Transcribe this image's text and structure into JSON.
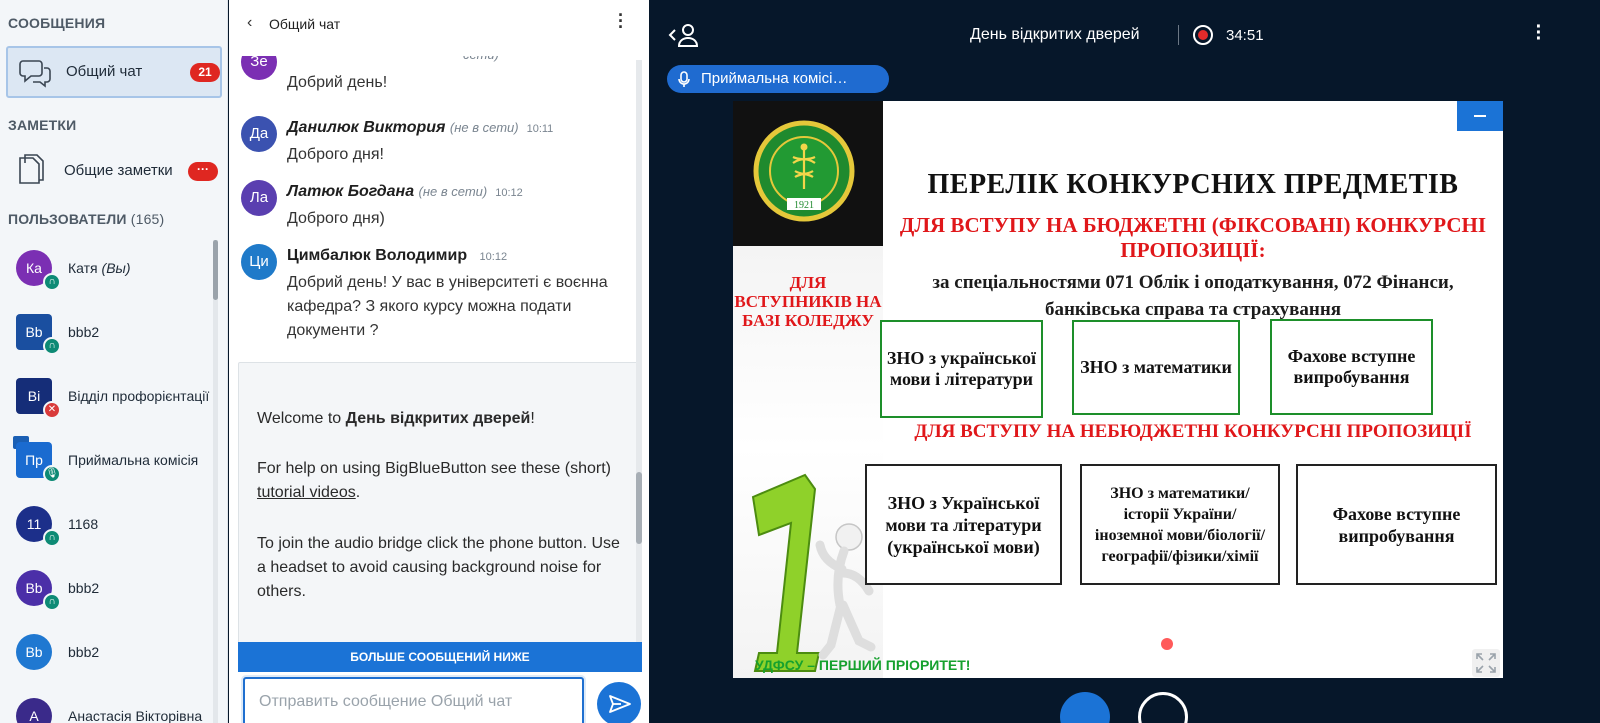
{
  "sidebar": {
    "messages_title": "СООБЩЕНИЯ",
    "public_chat": {
      "label": "Общий чат",
      "unread": "21"
    },
    "notes_title": "ЗАМЕТКИ",
    "shared_notes": {
      "label": "Общие заметки",
      "badge": "···"
    },
    "users_title": "ПОЛЬЗОВАТЕЛИ",
    "users_count": "(165)",
    "users": [
      {
        "initials": "Ка",
        "name": "Катя",
        "suffix": "(Вы)",
        "color": "#7b2fb3",
        "shape": "circle",
        "status": "headphones",
        "status_color": "#0d8a75"
      },
      {
        "initials": "Bb",
        "name": "bbb2",
        "suffix": "",
        "color": "#1a4fa0",
        "shape": "square",
        "status": "headphones",
        "status_color": "#0d8a75"
      },
      {
        "initials": "Bi",
        "name": "Відділ профорієнтації",
        "suffix": "",
        "color": "#152d78",
        "shape": "square",
        "status": "mic-muted",
        "status_color": "#d93b3b"
      },
      {
        "initials": "Пр",
        "name": "Приймальна комісія",
        "suffix": "",
        "color": "#1a6bd0",
        "shape": "square",
        "status": "mic",
        "status_color": "#0d8a75",
        "presenter": true
      },
      {
        "initials": "11",
        "name": "1168",
        "suffix": "",
        "color": "#1c2f8a",
        "shape": "circle",
        "status": "headphones",
        "status_color": "#0d8a75"
      },
      {
        "initials": "Bb",
        "name": "bbb2",
        "suffix": "",
        "color": "#4b2fa8",
        "shape": "circle",
        "status": "headphones",
        "status_color": "#0d8a75"
      },
      {
        "initials": "Bb",
        "name": "bbb2",
        "suffix": "",
        "color": "#1f78d1",
        "shape": "circle",
        "status": "",
        "status_color": ""
      },
      {
        "initials": "А",
        "name": "Анастасія Вікторівна",
        "suffix": "",
        "color": "#3a2a8a",
        "shape": "circle",
        "status": "",
        "status_color": ""
      }
    ]
  },
  "chat": {
    "title": "Общий чат",
    "messages": [
      {
        "initials": "Зе",
        "color": "#7b2fb3",
        "author": "",
        "offline": "сети)",
        "time": "",
        "text": "Добрий день!"
      },
      {
        "initials": "Да",
        "color": "#3b52b0",
        "author": "Данилюк Виктория",
        "offline": "(не в сети)",
        "time": "10:11",
        "text": "Доброго дня!"
      },
      {
        "initials": "Ла",
        "color": "#5a3fb0",
        "author": "Латюк Богдана",
        "offline": "(не в сети)",
        "time": "10:12",
        "text": "Доброго дня)"
      },
      {
        "initials": "Ци",
        "color": "#1f7ac9",
        "author": "Цимбалюк Володимир",
        "offline": "",
        "time": "10:12",
        "text": "Добрий день! У вас в університеті є воєнна кафедра? З якого курсу можна подати документи ?"
      }
    ],
    "welcome": {
      "prefix": "Welcome to ",
      "meeting": "День відкритих дверей",
      "suffix": "!",
      "help_prefix": "For help on using BigBlueButton see these (short) ",
      "help_link": "tutorial videos",
      "help_suffix": ".",
      "audio": "To join the audio bridge click the phone button. Use a headset to avoid causing background noise for others."
    },
    "more_messages": "БОЛЬШЕ СООБЩЕНИЙ НИЖЕ",
    "input_placeholder": "Отправить сообщение Общий чат"
  },
  "meeting": {
    "title": "День відкритих дверей",
    "recording_time": "34:51",
    "talking": "Приймальна комісі…"
  },
  "slide": {
    "seal_text": "1921",
    "side_text": "ДЛЯ ВСТУПНИКІВ НА БАЗІ КОЛЕДЖУ",
    "footer": "УДФСУ – ПЕРШИЙ ПРІОРИТЕТ!",
    "title": "ПЕРЕЛІК КОНКУРСНИХ ПРЕДМЕТІВ",
    "budget_heading": "ДЛЯ ВСТУПУ НА БЮДЖЕТНІ (ФІКСОВАНІ) КОНКУРСНІ ПРОПОЗИЦІЇ:",
    "specialties": "за спеціальностями 071 Облік і оподаткування, 072 Фінанси, банківська справа та страхування",
    "budget_boxes": [
      "ЗНО з української мови і літератури",
      "ЗНО з математики",
      "Фахове вступне випробування"
    ],
    "contract_heading": "ДЛЯ ВСТУПУ НА НЕБЮДЖЕТНІ КОНКУРСНІ ПРОПОЗИЦІЇ",
    "contract_boxes": [
      "ЗНО з Української мови та літератури (української мови)",
      "ЗНО з математики/історії України/іноземної мови/біології/географії/фізики/хімії",
      "Фахове вступне випробування"
    ]
  }
}
